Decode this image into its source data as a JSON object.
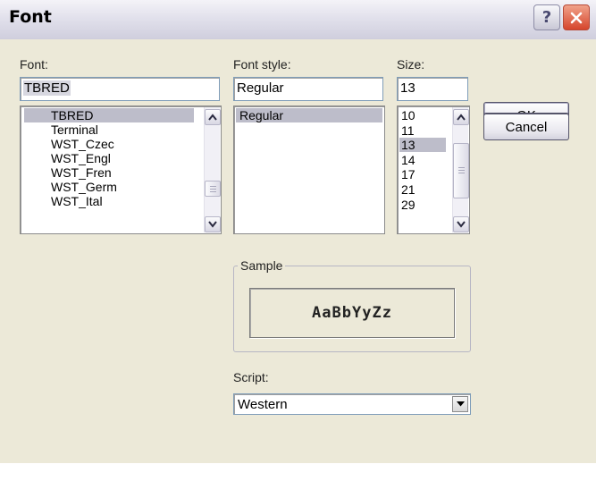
{
  "window": {
    "title": "Font",
    "help_glyph": "?",
    "close_icon": "close-x-icon"
  },
  "font": {
    "label": "Font:",
    "value": "TBRED",
    "items": [
      "TBRED",
      "Terminal",
      "WST_Czec",
      "WST_Engl",
      "WST_Fren",
      "WST_Germ",
      "WST_Ital"
    ],
    "selected_index": 0
  },
  "font_style": {
    "label": "Font style:",
    "value": "Regular",
    "items": [
      "Regular"
    ],
    "selected_index": 0
  },
  "size": {
    "label": "Size:",
    "value": "13",
    "items": [
      "10",
      "11",
      "13",
      "14",
      "17",
      "21",
      "29"
    ],
    "selected_index": 2
  },
  "buttons": {
    "ok": "OK",
    "cancel": "Cancel"
  },
  "sample": {
    "label": "Sample",
    "text": "AaBbYyZz"
  },
  "script": {
    "label": "Script:",
    "value": "Western"
  },
  "colors": {
    "dialog_bg": "#ece9d8",
    "selection": "#bdbdca",
    "close_button": "#d6452c"
  }
}
